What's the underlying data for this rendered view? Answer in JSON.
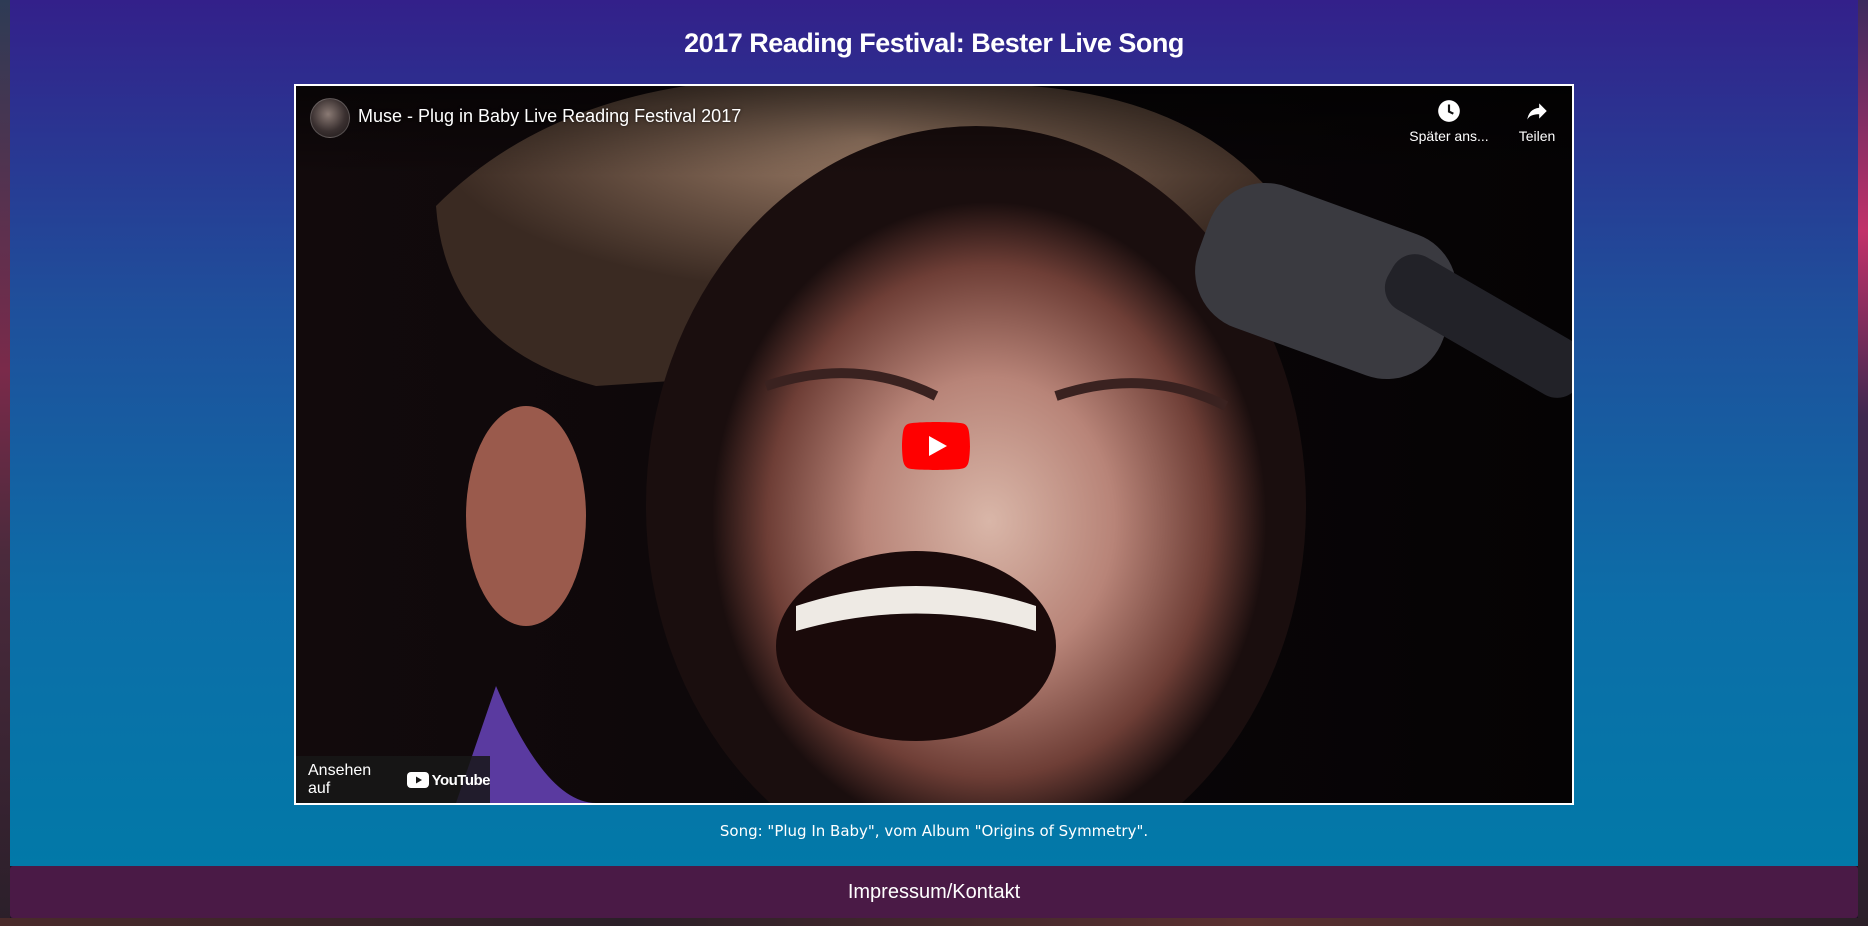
{
  "page": {
    "title": "2017 Reading Festival: Bester Live Song",
    "caption": "Song: \"Plug In Baby\", vom Album \"Origins of Symmetry\"."
  },
  "video": {
    "title": "Muse - Plug in Baby Live Reading Festival 2017",
    "watch_later_label": "Später ans...",
    "share_label": "Teilen",
    "watch_on_label": "Ansehen auf",
    "youtube_logo_text": "YouTube",
    "icons": {
      "avatar": "channel-avatar",
      "watch_later": "clock-icon",
      "share": "share-arrow-icon",
      "play": "youtube-play-icon"
    },
    "colors": {
      "play_red": "#ff0000"
    }
  },
  "footer": {
    "link_label": "Impressum/Kontakt"
  },
  "colors": {
    "background_top": "#33208a",
    "background_bottom": "#0279a8",
    "footer": "#4a1a46"
  }
}
